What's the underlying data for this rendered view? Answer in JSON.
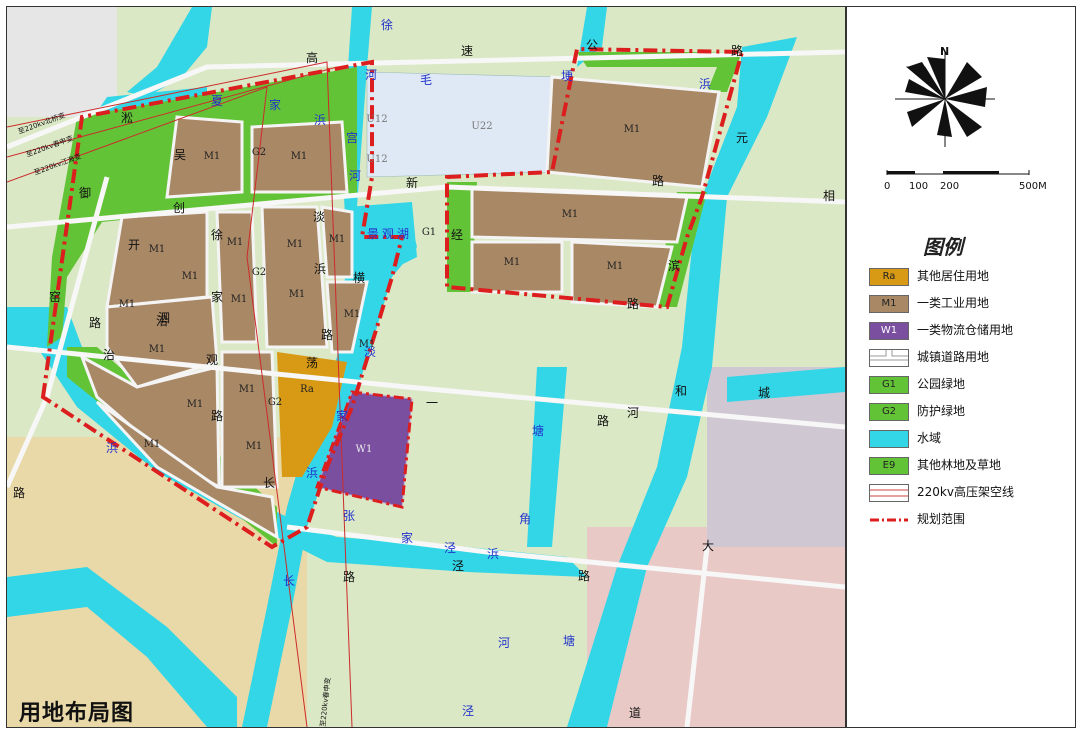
{
  "map": {
    "title": "用地布局图",
    "zones": [
      {
        "code": "M1"
      },
      {
        "code": "M1"
      },
      {
        "code": "M1"
      },
      {
        "code": "M1"
      },
      {
        "code": "M1"
      },
      {
        "code": "M1"
      },
      {
        "code": "M1"
      },
      {
        "code": "M1"
      },
      {
        "code": "M1"
      },
      {
        "code": "M1"
      },
      {
        "code": "M1"
      },
      {
        "code": "M1"
      },
      {
        "code": "M1"
      },
      {
        "code": "M1"
      },
      {
        "code": "M1"
      },
      {
        "code": "M1"
      },
      {
        "code": "M1"
      },
      {
        "code": "M1"
      },
      {
        "code": "M1"
      },
      {
        "code": "M1"
      },
      {
        "code": "M1"
      }
    ],
    "zone_ra": "Ra",
    "zone_w1": "W1",
    "zone_g1": "G1",
    "zone_g2": [
      "G2",
      "G2",
      "G2"
    ],
    "zone_u": [
      "U12",
      "U22",
      "U12"
    ],
    "road_chars": [
      "高",
      "速",
      "公",
      "路",
      "新",
      "路",
      "开",
      "创",
      "路",
      "沿",
      "河",
      "治",
      "长",
      "路",
      "泾",
      "一",
      "路",
      "大",
      "道",
      "御",
      "窑",
      "路",
      "吴",
      "淞",
      "路",
      "徐",
      "家",
      "泗",
      "观",
      "路",
      "淡",
      "浜",
      "横",
      "路",
      "荡",
      "经",
      "滨",
      "路",
      "元",
      "和",
      "城",
      "相"
    ],
    "water_chars": [
      "夏",
      "家",
      "浜",
      "宫",
      "河",
      "毛",
      "埂",
      "浜",
      "景",
      "观",
      "湖",
      "淡",
      "家",
      "浜",
      "家",
      "泾",
      "浜",
      "张",
      "长",
      "塘",
      "角",
      "河",
      "塘",
      "徐",
      "泾",
      "浜",
      "河",
      "家"
    ],
    "power_labels": [
      "至220kv北桥变",
      "至220kv春申变",
      "至220kv江海变",
      "至220kv春申变"
    ]
  },
  "compass": {
    "north": "N"
  },
  "scale": {
    "ticks": [
      "0",
      "100",
      "200",
      "500M"
    ]
  },
  "legend": {
    "title": "图例",
    "items": [
      {
        "code": "Ra",
        "label": "其他居住用地",
        "color": "#d89a14"
      },
      {
        "code": "M1",
        "label": "一类工业用地",
        "color": "#a98866"
      },
      {
        "code": "W1",
        "label": "一类物流仓储用地",
        "color": "#7a4fa0"
      },
      {
        "code": "",
        "label": "城镇道路用地",
        "color": "#ffffff"
      },
      {
        "code": "G1",
        "label": "公园绿地",
        "color": "#63c337"
      },
      {
        "code": "G2",
        "label": "防护绿地",
        "color": "#63c337"
      },
      {
        "code": "",
        "label": "水域",
        "color": "#33d6e6"
      },
      {
        "code": "E9",
        "label": "其他林地及草地",
        "color": "#63c337"
      },
      {
        "code": "",
        "label": "220kv高压架空线",
        "color": "#ffffff"
      },
      {
        "code": "",
        "label": "规划范围",
        "color": "#ffffff"
      }
    ]
  },
  "colors": {
    "industrial": "#a98866",
    "water": "#33d6e6",
    "green": "#63c337",
    "residential": "#d89a14",
    "logistics": "#7a4fa0",
    "utility": "#dfe9f5",
    "boundary": "#dd1e1e"
  }
}
